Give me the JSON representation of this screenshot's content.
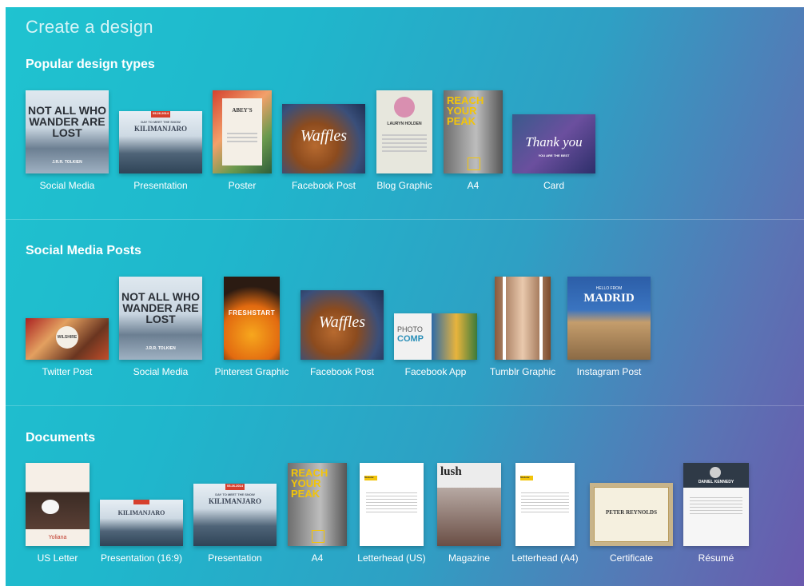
{
  "page": {
    "title": "Create a design"
  },
  "sections": [
    {
      "title": "Popular design types",
      "items": [
        {
          "label": "Social Media"
        },
        {
          "label": "Presentation"
        },
        {
          "label": "Poster"
        },
        {
          "label": "Facebook Post"
        },
        {
          "label": "Blog Graphic"
        },
        {
          "label": "A4"
        },
        {
          "label": "Card"
        }
      ]
    },
    {
      "title": "Social Media Posts",
      "items": [
        {
          "label": "Twitter Post"
        },
        {
          "label": "Social Media"
        },
        {
          "label": "Pinterest Graphic"
        },
        {
          "label": "Facebook Post"
        },
        {
          "label": "Facebook App"
        },
        {
          "label": "Tumblr Graphic"
        },
        {
          "label": "Instagram Post"
        }
      ]
    },
    {
      "title": "Documents",
      "items": [
        {
          "label": "US Letter"
        },
        {
          "label": "Presentation (16:9)"
        },
        {
          "label": "Presentation"
        },
        {
          "label": "A4"
        },
        {
          "label": "Letterhead (US)"
        },
        {
          "label": "Magazine"
        },
        {
          "label": "Letterhead (A4)"
        },
        {
          "label": "Certificate"
        },
        {
          "label": "Résumé"
        }
      ]
    }
  ],
  "thumbnail_text": {
    "not_all_who_wander": "NOT ALL WHO WANDER ARE LOST",
    "tolkien": "J.R.R. TOLKIEN",
    "kilimanjaro": "KILIMANJARO",
    "kili_date": "05.26.2014",
    "kili_small": "DAY TO MEET THE SNOW",
    "abeys": "ABEY'S",
    "waffles": "Waffles",
    "lauryn": "LAURYN HOLDEN",
    "reach": "REACH YOUR PEAK",
    "thank_you": "Thank you",
    "thank_small": "YOU ARE THE BEST",
    "wilshire": "WILSHIRE",
    "freshstart": "FRESHSTART",
    "photo": "PHOTO",
    "comp": "COMP",
    "hello_from": "HELLO FROM",
    "madrid": "MADRID",
    "yoliana": "Yoliana",
    "lush": "lush",
    "peter": "PETER REYNOLDS",
    "daniel": "DANIEL KENNEDY",
    "modular": "Modular"
  }
}
